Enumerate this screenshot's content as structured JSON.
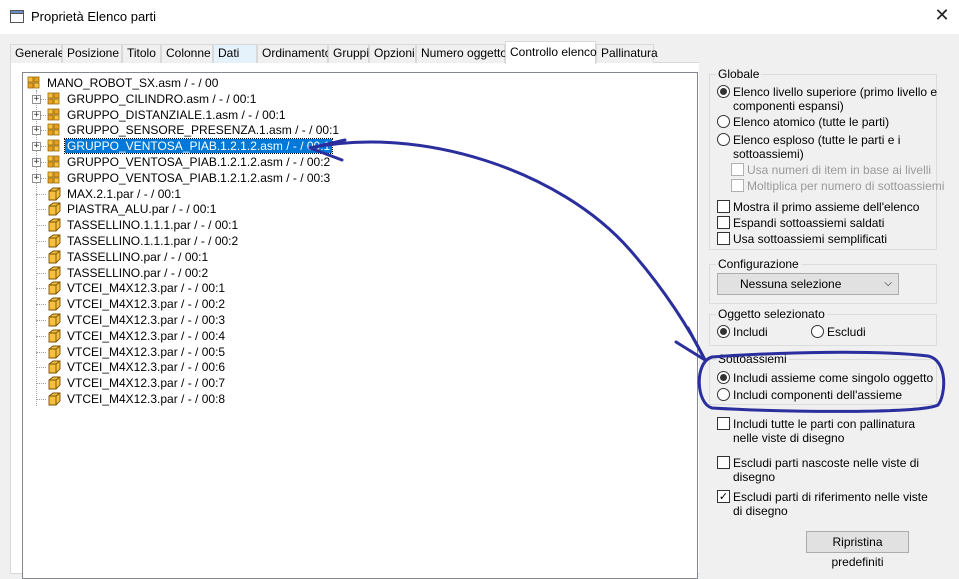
{
  "window": {
    "title": "Proprietà Elenco parti",
    "close_symbol": "✕",
    "icon": "dialog-icon"
  },
  "tabs": [
    {
      "label": "Generale"
    },
    {
      "label": "Posizione"
    },
    {
      "label": "Titolo"
    },
    {
      "label": "Colonne"
    },
    {
      "label": "Dati"
    },
    {
      "label": "Ordinamento"
    },
    {
      "label": "Gruppi"
    },
    {
      "label": "Opzioni"
    },
    {
      "label": "Numero oggetto"
    },
    {
      "label": "Controllo elenco"
    },
    {
      "label": "Pallinatura"
    }
  ],
  "tree": {
    "root": {
      "label": "MANO_ROBOT_SX.asm / - / 00",
      "icon": "assembly-icon"
    },
    "items": [
      {
        "label": "GRUPPO_CILINDRO.asm / - / 00:1",
        "icon": "assembly-icon",
        "expander": "+"
      },
      {
        "label": "GRUPPO_DISTANZIALE.1.asm / - / 00:1",
        "icon": "assembly-icon",
        "expander": "+"
      },
      {
        "label": "GRUPPO_SENSORE_PRESENZA.1.asm / - / 00:1",
        "icon": "assembly-icon",
        "expander": "+"
      },
      {
        "label": "GRUPPO_VENTOSA_PIAB.1.2.1.2.asm / - / 00:1",
        "icon": "assembly-icon",
        "expander": "+"
      },
      {
        "label": "GRUPPO_VENTOSA_PIAB.1.2.1.2.asm / - / 00:2",
        "icon": "assembly-icon",
        "expander": "+"
      },
      {
        "label": "GRUPPO_VENTOSA_PIAB.1.2.1.2.asm / - / 00:3",
        "icon": "assembly-icon",
        "expander": "+"
      },
      {
        "label": "MAX.2.1.par / - / 00:1",
        "icon": "part-icon"
      },
      {
        "label": "PIASTRA_ALU.par / - / 00:1",
        "icon": "part-icon"
      },
      {
        "label": "TASSELLINO.1.1.1.par / - / 00:1",
        "icon": "part-icon"
      },
      {
        "label": "TASSELLINO.1.1.1.par / - / 00:2",
        "icon": "part-icon"
      },
      {
        "label": "TASSELLINO.par / - / 00:1",
        "icon": "part-icon"
      },
      {
        "label": "TASSELLINO.par / - / 00:2",
        "icon": "part-icon"
      },
      {
        "label": "VTCEI_M4X12.3.par / - / 00:1",
        "icon": "part-icon"
      },
      {
        "label": "VTCEI_M4X12.3.par / - / 00:2",
        "icon": "part-icon"
      },
      {
        "label": "VTCEI_M4X12.3.par / - / 00:3",
        "icon": "part-icon"
      },
      {
        "label": "VTCEI_M4X12.3.par / - / 00:4",
        "icon": "part-icon"
      },
      {
        "label": "VTCEI_M4X12.3.par / - / 00:5",
        "icon": "part-icon"
      },
      {
        "label": "VTCEI_M4X12.3.par / - / 00:6",
        "icon": "part-icon"
      },
      {
        "label": "VTCEI_M4X12.3.par / - / 00:7",
        "icon": "part-icon"
      },
      {
        "label": "VTCEI_M4X12.3.par / - / 00:8",
        "icon": "part-icon"
      }
    ]
  },
  "globale": {
    "title": "Globale",
    "opt1_line1": "Elenco livello superiore (primo livello e",
    "opt1_line2": "componenti espansi)",
    "opt2": "Elenco atomico (tutte le parti)",
    "opt3_line1": "Elenco esploso (tutte le parti e i",
    "opt3_line2": "sottoassiemi)",
    "sub1": "Usa numeri di item in base ai livelli",
    "sub2": "Moltiplica per numero di sottoassiemi",
    "chk1": "Mostra il primo assieme dell'elenco",
    "chk2": "Espandi sottoassiemi saldati",
    "chk3": "Usa sottoassiemi semplificati"
  },
  "configurazione": {
    "title": "Configurazione",
    "selected": "Nessuna selezione",
    "arrow": "⌵"
  },
  "oggetto": {
    "title": "Oggetto selezionato",
    "includi": "Includi",
    "escludi": "Escludi"
  },
  "sottoassiemi": {
    "title": "Sottoassiemi",
    "opt1": "Includi assieme come singolo oggetto",
    "opt2": "Includi componenti dell'assieme"
  },
  "extra": {
    "chk1_line1": "Includi tutte le parti con pallinatura",
    "chk1_line2": "nelle viste di disegno",
    "chk2_line1": "Escludi parti nascoste nelle viste di",
    "chk2_line2": "disegno",
    "chk3_line1": "Escludi parti di riferimento nelle viste",
    "chk3_line2": "di disegno",
    "checkmark": "✓"
  },
  "buttons": {
    "reset": "Ripristina predefiniti"
  },
  "colors": {
    "selection": "#0078d7",
    "annotation": "#2b2f9e",
    "assembly_icon": "#e8a020",
    "part_icon": "#f5c040"
  }
}
